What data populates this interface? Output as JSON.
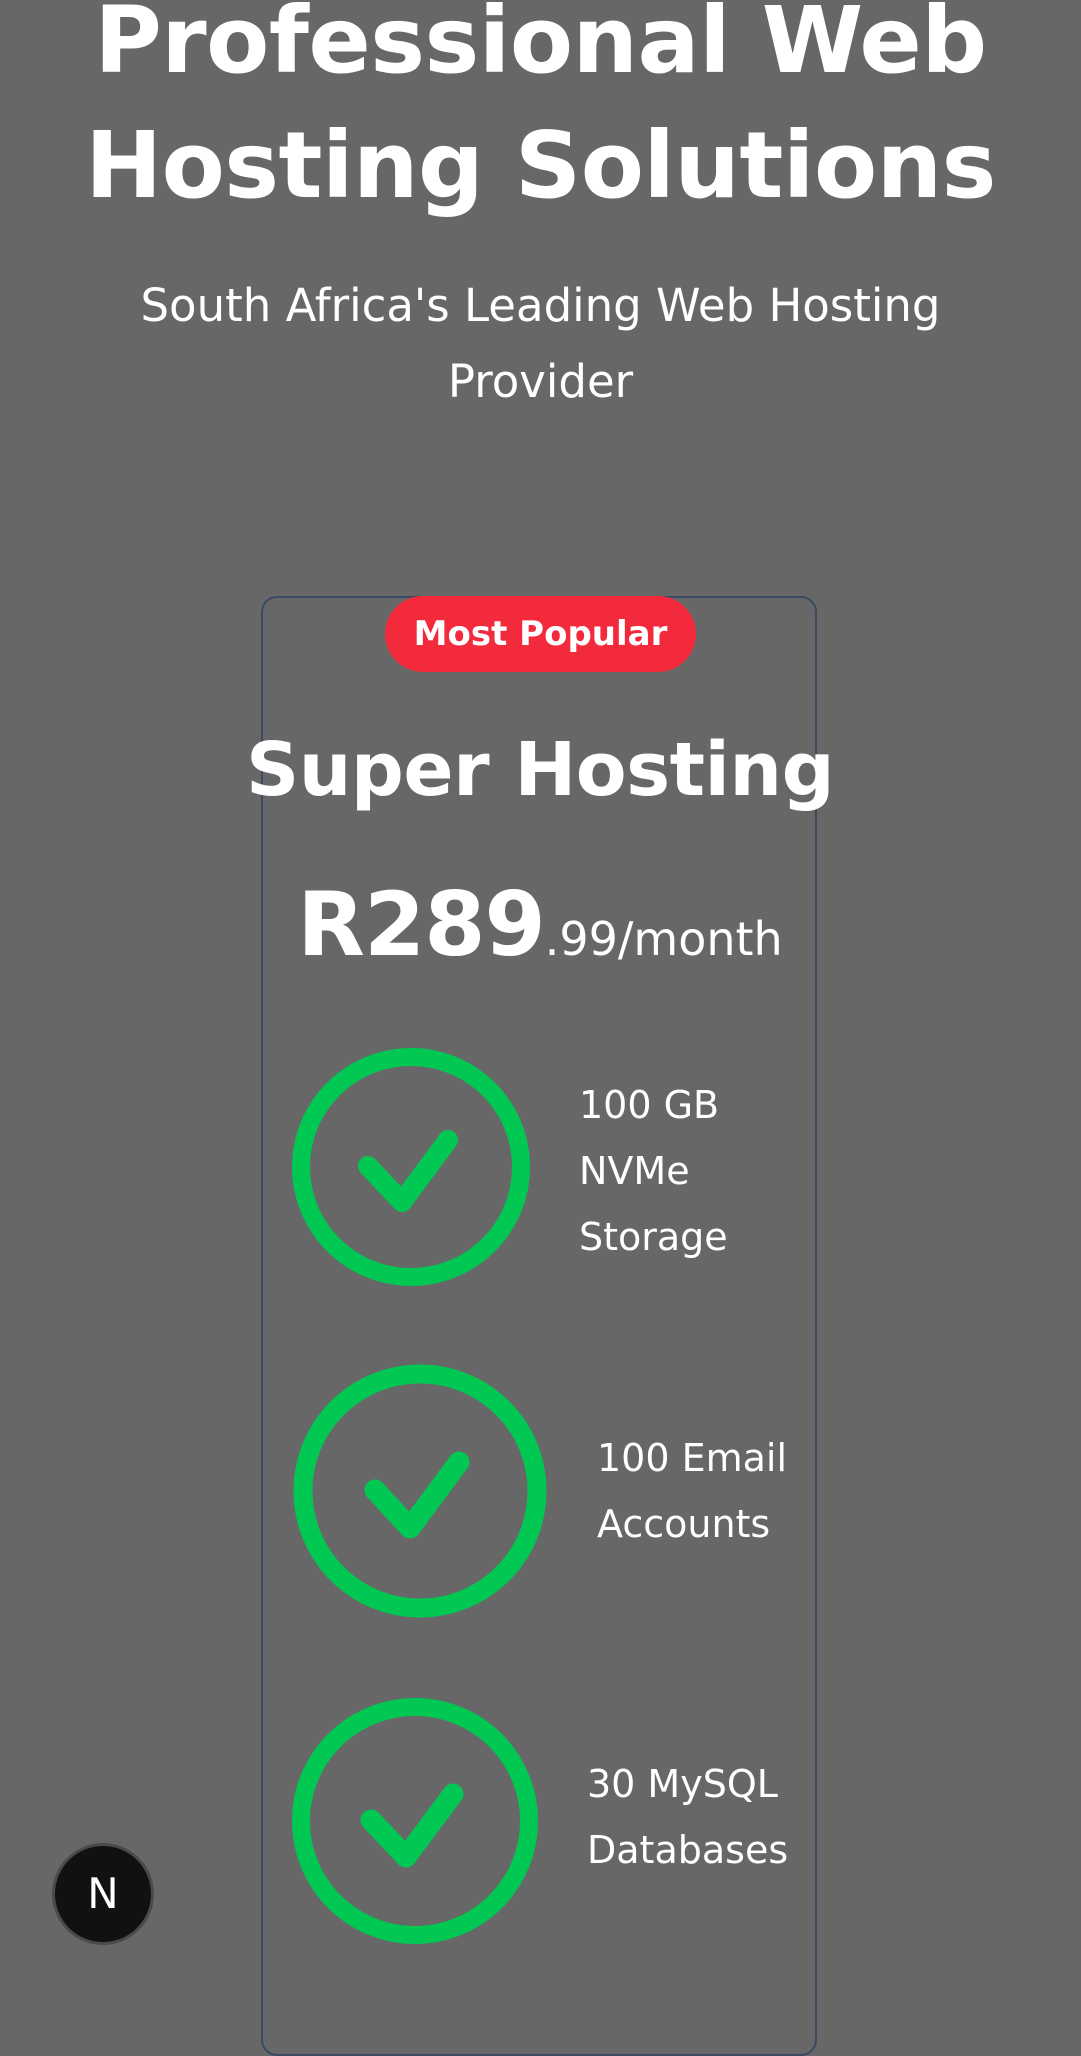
{
  "hero": {
    "title": "Professional Web Hosting Solutions",
    "subtitle": "South Africa's Leading Web Hosting Provider"
  },
  "plan": {
    "badge": "Most Popular",
    "name": "Super Hosting",
    "price_main": "R289",
    "price_suffix": ".99/month",
    "features": [
      {
        "text": "100 GB\nNVMe\nStorage",
        "icon": "check-circle-icon"
      },
      {
        "text": "100 Email\nAccounts",
        "icon": "check-circle-icon"
      },
      {
        "text": "30 MySQL\nDatabases",
        "icon": "check-circle-icon"
      }
    ]
  },
  "dev_indicator": {
    "label": "N",
    "icon": "nextjs-logo-icon"
  },
  "colors": {
    "background": "#676767",
    "badge": "#f22a3c",
    "check": "#00c853",
    "card_border": "#3a4a63"
  }
}
